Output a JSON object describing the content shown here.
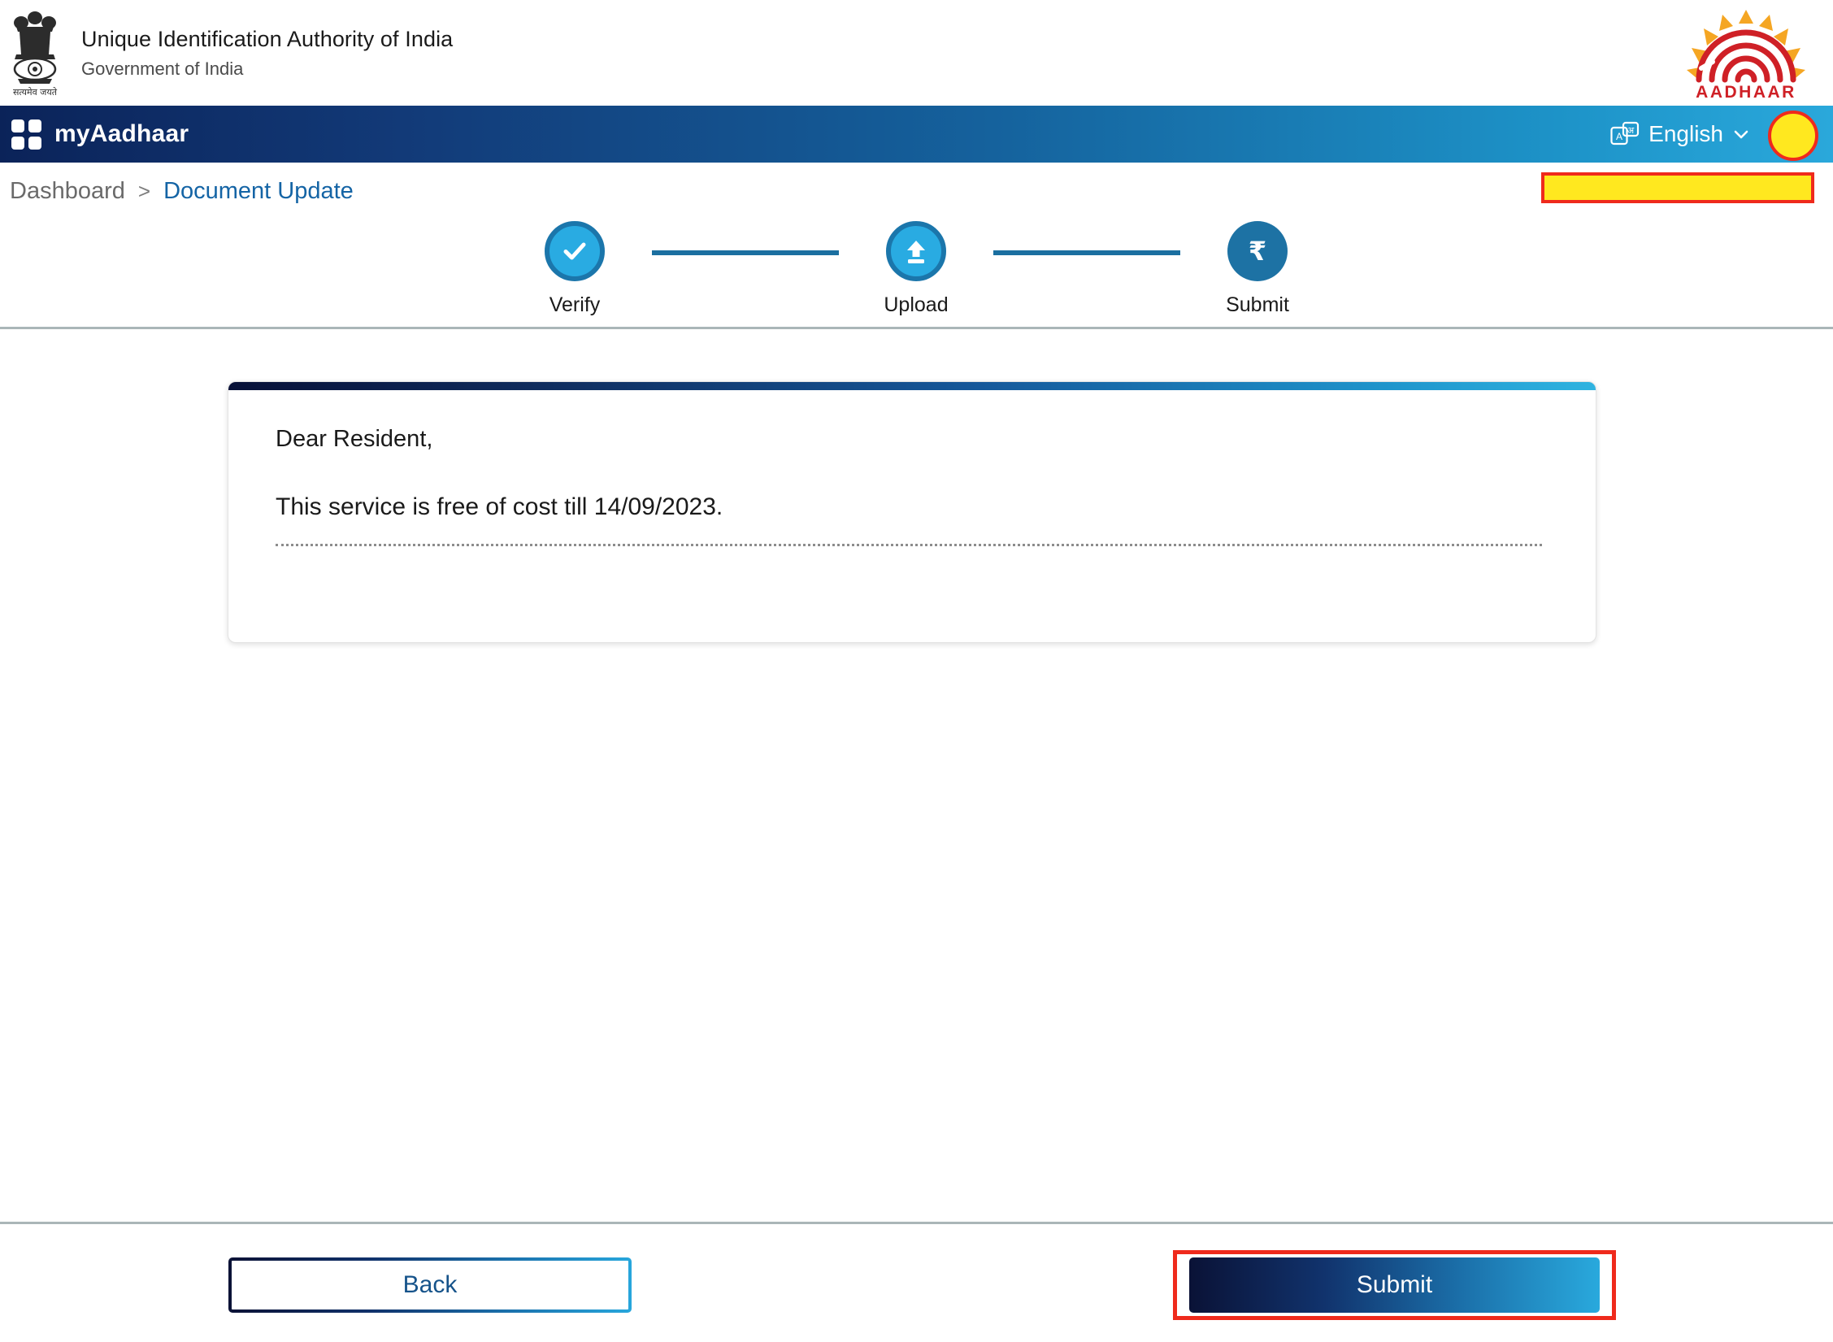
{
  "header": {
    "emblem_icon": "india-national-emblem",
    "emblem_motto": "सत्यमेव जयते",
    "org_title": "Unique Identification Authority of India",
    "org_subtitle": "Government of India",
    "aadhaar_logo_text": "AADHAAR",
    "aadhaar_logo_icon": "aadhaar-fingerprint-sun-logo"
  },
  "navbar": {
    "brand": "myAadhaar",
    "brand_icon": "four-squares-grid-icon",
    "language_icon": "language-translate-icon",
    "language_icon_glyphs": {
      "latin": "A",
      "devanagari": "अ"
    },
    "language": "English",
    "chevron_icon": "chevron-down-icon",
    "avatar_icon": "user-avatar",
    "colors": {
      "gradient_start": "#0b2359",
      "gradient_end": "#2aa8db",
      "avatar_fill": "#ffe81f",
      "annotation_border": "#ef2a1c"
    }
  },
  "breadcrumb": {
    "home": "Dashboard",
    "separator": ">",
    "current": "Document Update",
    "redaction_box": {
      "fill": "#ffe81f",
      "border": "#ef2a1c"
    }
  },
  "stepper": {
    "steps": [
      {
        "label": "Verify",
        "icon": "check-icon",
        "state": "active"
      },
      {
        "label": "Upload",
        "icon": "upload-icon",
        "state": "active"
      },
      {
        "label": "Submit",
        "icon": "rupee-icon",
        "state": "pending"
      }
    ],
    "colors": {
      "active_fill": "#29abe2",
      "active_ring": "#1b76ab",
      "pending_fill": "#1d72a4",
      "connector": "#1b6fa0"
    }
  },
  "card": {
    "greeting": "Dear Resident,",
    "message": "This service is free of cost till 14/09/2023.",
    "topbar_gradient_start": "#081138",
    "topbar_gradient_end": "#2fb3e0"
  },
  "footer": {
    "back_label": "Back",
    "submit_label": "Submit",
    "submit_highlight_border": "#ef2a1c"
  }
}
